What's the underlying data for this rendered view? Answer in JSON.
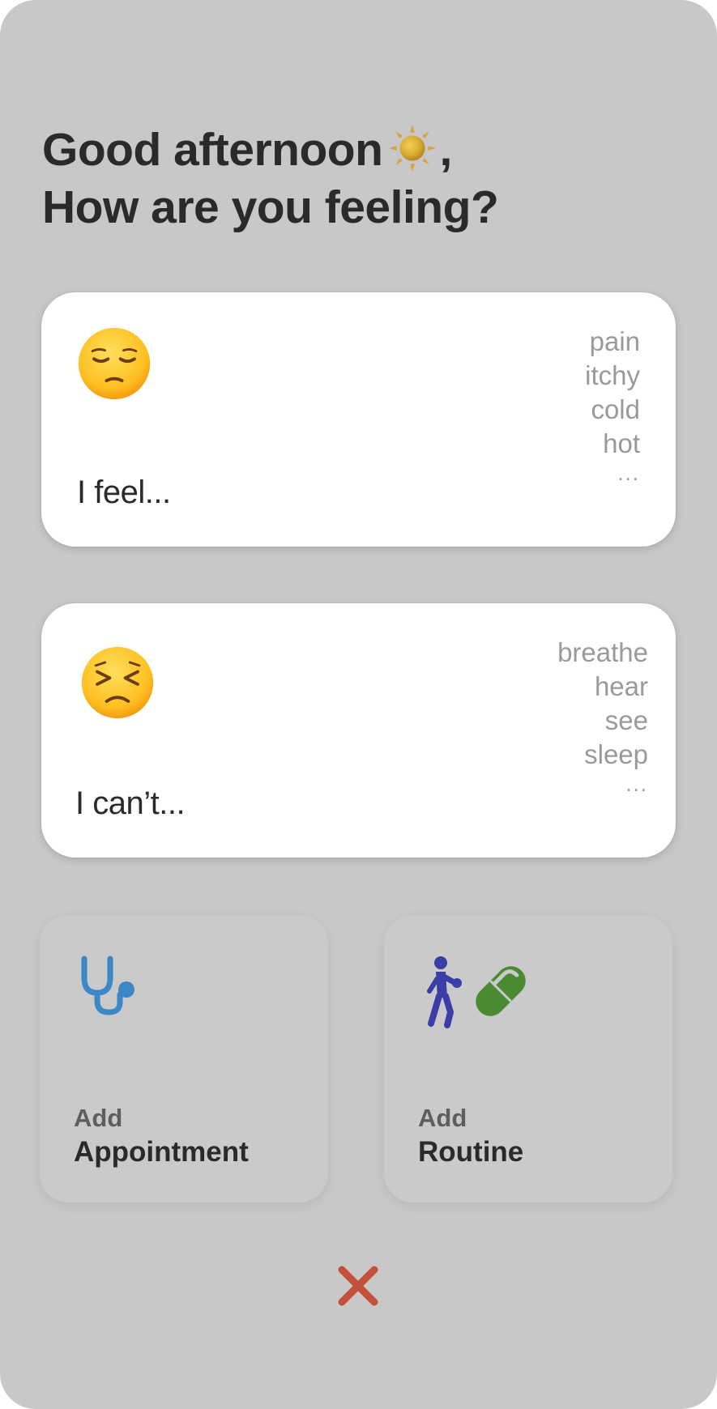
{
  "greeting": {
    "line1_text": "Good afternoon",
    "line1_suffix": ",",
    "line2_text": "How are you feeling?",
    "icon": "sun-icon"
  },
  "cards": {
    "feel": {
      "title": "I feel...",
      "emoji": "pensive-face-icon",
      "options": [
        "pain",
        "itchy",
        "cold",
        "hot"
      ],
      "more": "..."
    },
    "cant": {
      "title": "I can’t...",
      "emoji": "persevering-face-icon",
      "options": [
        "breathe",
        "hear",
        "see",
        "sleep"
      ],
      "more": "..."
    }
  },
  "tiles": {
    "appointment": {
      "sub": "Add",
      "main": "Appointment",
      "icon": "stethoscope-icon",
      "icon_color": "#3d87c6"
    },
    "routine": {
      "sub": "Add",
      "main": "Routine",
      "icons": [
        "exercise-person-icon",
        "pill-icon"
      ],
      "icon_colors": [
        "#3b3ea6",
        "#4a8a33"
      ]
    }
  },
  "close": {
    "icon": "close-icon",
    "color": "#c4503a"
  },
  "colors": {
    "background": "#c8c8c8",
    "card": "#ffffff",
    "text": "#2a2a2a",
    "muted": "#9a9a9a"
  }
}
